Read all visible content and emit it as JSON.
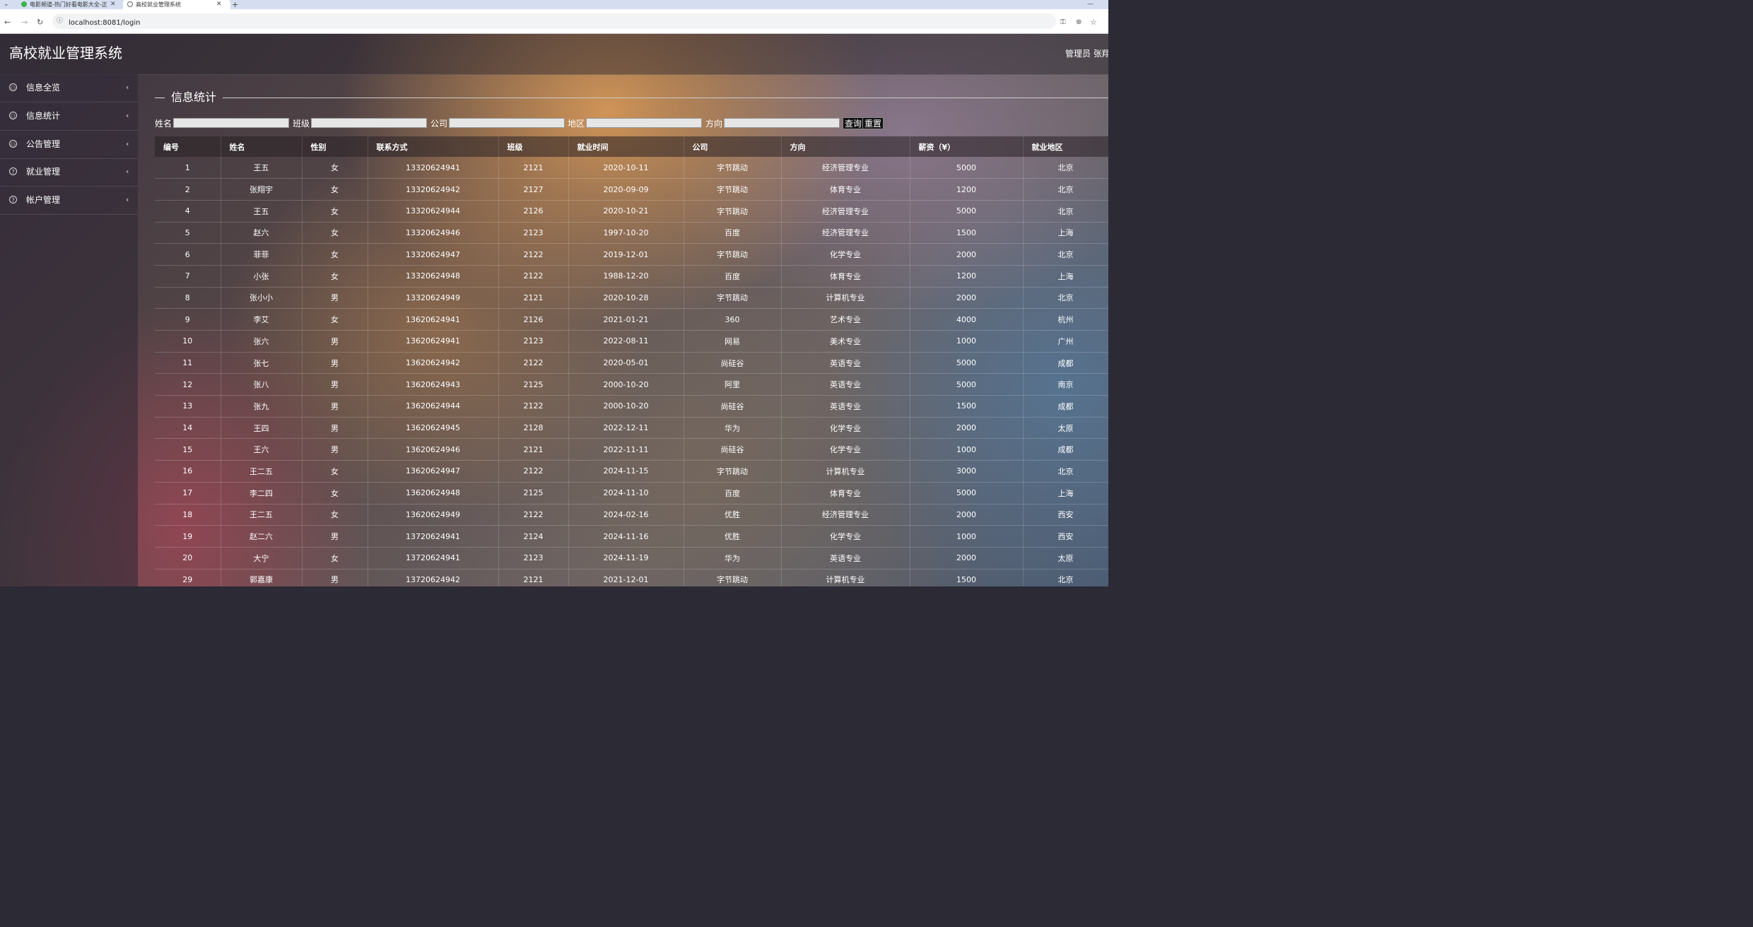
{
  "browser": {
    "tabs": [
      {
        "title": "电影频道-热门好看电影大全-正",
        "active": false
      },
      {
        "title": "高校就业管理系统",
        "active": true
      }
    ],
    "url": "localhost:8081/login"
  },
  "header": {
    "title": "高校就业管理系统",
    "user": "管理员 张翔"
  },
  "sidebar": {
    "items": [
      {
        "label": "信息全览",
        "icon": "user-circle-icon"
      },
      {
        "label": "信息统计",
        "icon": "user-circle-icon"
      },
      {
        "label": "公告管理",
        "icon": "user-circle-icon"
      },
      {
        "label": "就业管理",
        "icon": "help-circle-icon"
      },
      {
        "label": "帐户管理",
        "icon": "help-circle-icon"
      }
    ]
  },
  "section": {
    "title": "信息统计"
  },
  "search": {
    "fields": [
      {
        "label": "姓名",
        "value": ""
      },
      {
        "label": "班级",
        "value": ""
      },
      {
        "label": "公司",
        "value": ""
      },
      {
        "label": "地区",
        "value": ""
      },
      {
        "label": "方向",
        "value": ""
      }
    ],
    "query_label": "查询",
    "reset_label": "重置"
  },
  "table": {
    "columns": [
      "编号",
      "姓名",
      "性别",
      "联系方式",
      "班级",
      "就业时间",
      "公司",
      "方向",
      "薪资（¥）",
      "就业地区"
    ],
    "rows": [
      [
        "1",
        "王五",
        "女",
        "13320624941",
        "2121",
        "2020-10-11",
        "字节跳动",
        "经济管理专业",
        "5000",
        "北京"
      ],
      [
        "2",
        "张翔宇",
        "女",
        "13320624942",
        "2127",
        "2020-09-09",
        "字节跳动",
        "体育专业",
        "1200",
        "北京"
      ],
      [
        "4",
        "王五",
        "女",
        "13320624944",
        "2126",
        "2020-10-21",
        "字节跳动",
        "经济管理专业",
        "5000",
        "北京"
      ],
      [
        "5",
        "赵六",
        "女",
        "13320624946",
        "2123",
        "1997-10-20",
        "百度",
        "经济管理专业",
        "1500",
        "上海"
      ],
      [
        "6",
        "菲菲",
        "女",
        "13320624947",
        "2122",
        "2019-12-01",
        "字节跳动",
        "化学专业",
        "2000",
        "北京"
      ],
      [
        "7",
        "小张",
        "女",
        "13320624948",
        "2122",
        "1988-12-20",
        "百度",
        "体育专业",
        "1200",
        "上海"
      ],
      [
        "8",
        "张小小",
        "男",
        "13320624949",
        "2121",
        "2020-10-28",
        "字节跳动",
        "计算机专业",
        "2000",
        "北京"
      ],
      [
        "9",
        "李艾",
        "女",
        "13620624941",
        "2126",
        "2021-01-21",
        "360",
        "艺术专业",
        "4000",
        "杭州"
      ],
      [
        "10",
        "张六",
        "男",
        "13620624941",
        "2123",
        "2022-08-11",
        "网易",
        "美术专业",
        "1000",
        "广州"
      ],
      [
        "11",
        "张七",
        "男",
        "13620624942",
        "2122",
        "2020-05-01",
        "尚硅谷",
        "英语专业",
        "5000",
        "成都"
      ],
      [
        "12",
        "张八",
        "男",
        "13620624943",
        "2125",
        "2000-10-20",
        "阿里",
        "英语专业",
        "5000",
        "南京"
      ],
      [
        "13",
        "张九",
        "男",
        "13620624944",
        "2122",
        "2000-10-20",
        "尚硅谷",
        "英语专业",
        "1500",
        "成都"
      ],
      [
        "14",
        "王四",
        "男",
        "13620624945",
        "2128",
        "2022-12-11",
        "华为",
        "化学专业",
        "2000",
        "太原"
      ],
      [
        "15",
        "王六",
        "男",
        "13620624946",
        "2121",
        "2022-11-11",
        "尚硅谷",
        "化学专业",
        "1000",
        "成都"
      ],
      [
        "16",
        "王二五",
        "女",
        "13620624947",
        "2122",
        "2024-11-15",
        "字节跳动",
        "计算机专业",
        "3000",
        "北京"
      ],
      [
        "17",
        "李二四",
        "女",
        "13620624948",
        "2125",
        "2024-11-10",
        "百度",
        "体育专业",
        "5000",
        "上海"
      ],
      [
        "18",
        "王二五",
        "女",
        "13620624949",
        "2122",
        "2024-02-16",
        "优胜",
        "经济管理专业",
        "2000",
        "西安"
      ],
      [
        "19",
        "赵二六",
        "男",
        "13720624941",
        "2124",
        "2024-11-16",
        "优胜",
        "化学专业",
        "1000",
        "西安"
      ],
      [
        "20",
        "大宁",
        "女",
        "13720624941",
        "2123",
        "2024-11-19",
        "华为",
        "英语专业",
        "2000",
        "太原"
      ],
      [
        "29",
        "郭嘉康",
        "男",
        "13720624942",
        "2121",
        "2021-12-01",
        "字节跳动",
        "计算机专业",
        "1500",
        "北京"
      ]
    ]
  }
}
